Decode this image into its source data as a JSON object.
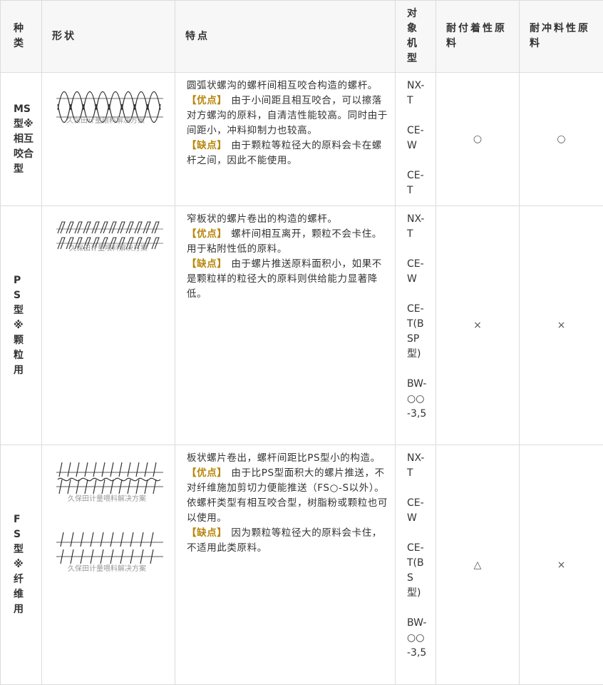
{
  "headers": {
    "kind": "种类",
    "shape": "形状",
    "features": "特点",
    "machines": "对象机型",
    "adhesive": "耐付着性原料",
    "impact": "耐冲料性原料"
  },
  "watermark": "久保田计量喂料解决方案",
  "rows": [
    {
      "kind": "MS型※相互咬合型",
      "description": "圆弧状螺沟的螺杆间相互咬合构造的螺杆。",
      "pros_label": "【优点】",
      "pros": "由于小间距且相互咬合，可以擦落对方螺沟的原料，自清洁性能较高。同时由于间距小，冲料抑制力也较高。",
      "cons_label": "【缺点】",
      "cons": "由于颗粒等粒径大的原料会卡在螺杆之间，因此不能使用。",
      "machines": [
        "NX-T",
        "CE-W",
        "CE-T"
      ],
      "adhesive": "○",
      "impact": "○"
    },
    {
      "kind": "PS型※颗粒用",
      "description": "窄板状的螺片卷出的构造的螺杆。",
      "pros_label": "【优点】",
      "pros": "螺杆间相互离开，颗粒不会卡住。用于粘附性低的原料。",
      "cons_label": "【缺点】",
      "cons": "由于螺片推送原料面积小，如果不是颗粒样的粒径大的原料则供给能力显著降低。",
      "machines": [
        "NX-T",
        "CE-W",
        "CE-T(BSP型)",
        "BW-○○-3,5"
      ],
      "adhesive": "×",
      "impact": "×"
    },
    {
      "kind": "FS型※纤维用",
      "description": "板状螺片卷出，螺杆间距比PS型小的构造。",
      "pros_label": "【优点】",
      "pros": "由于比PS型面积大的螺片推送，不对纤维施加剪切力便能推送（FS○-S以外）。依螺杆类型有相互咬合型，树脂粉或颗粒也可以使用。",
      "cons_label": "【缺点】",
      "cons": "因为颗粒等粒径大的原料会卡住，不适用此类原料。",
      "machines": [
        "NX-T",
        "CE-W",
        "CE-T(BS型)",
        "BW-○○-3,5"
      ],
      "adhesive": "△",
      "impact": "×"
    }
  ]
}
